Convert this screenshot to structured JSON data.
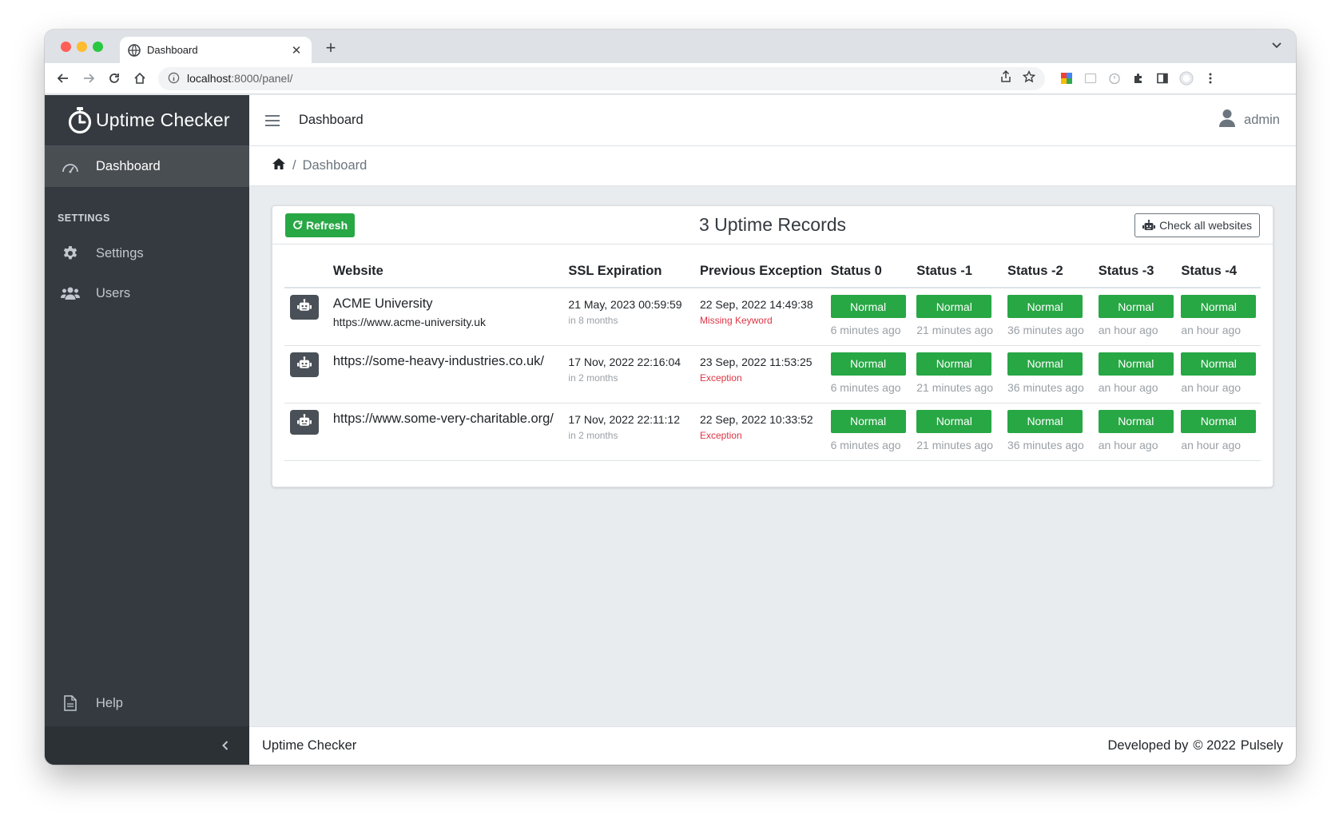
{
  "browser": {
    "tab_title": "Dashboard",
    "tab_close": "✕",
    "new_tab": "+",
    "url_host": "localhost",
    "url_path": ":8000/panel/"
  },
  "sidebar": {
    "brand": "Uptime Checker",
    "items": [
      {
        "label": "Dashboard",
        "icon": "tachometer-icon"
      },
      {
        "label": "Settings",
        "icon": "gear-icon"
      },
      {
        "label": "Users",
        "icon": "users-icon"
      }
    ],
    "section_header": "SETTINGS",
    "help_label": "Help",
    "collapse_glyph": "‹"
  },
  "topnav": {
    "title": "Dashboard",
    "user": "admin"
  },
  "breadcrumb": {
    "separator": "/",
    "current": "Dashboard"
  },
  "card": {
    "refresh_label": "Refresh",
    "title": "3 Uptime Records",
    "check_all_label": "Check all websites"
  },
  "table": {
    "headers": [
      "Website",
      "SSL Expiration",
      "Previous Exception",
      "Status 0",
      "Status -1",
      "Status -2",
      "Status -3",
      "Status -4"
    ],
    "rows": [
      {
        "name": "ACME University",
        "url": "https://www.acme-university.uk",
        "ssl_date": "21 May, 2023 00:59:59",
        "ssl_rel": "in 8 months",
        "exc_date": "22 Sep, 2022 14:49:38",
        "exc_type": "Missing Keyword",
        "statuses": [
          {
            "label": "Normal",
            "time": "6 minutes ago"
          },
          {
            "label": "Normal",
            "time": "21 minutes ago"
          },
          {
            "label": "Normal",
            "time": "36 minutes ago"
          },
          {
            "label": "Normal",
            "time": "an hour ago"
          },
          {
            "label": "Normal",
            "time": "an hour ago"
          }
        ]
      },
      {
        "name": "https://some-heavy-industries.co.uk/",
        "url": "",
        "ssl_date": "17 Nov, 2022 22:16:04",
        "ssl_rel": "in 2 months",
        "exc_date": "23 Sep, 2022 11:53:25",
        "exc_type": "Exception",
        "statuses": [
          {
            "label": "Normal",
            "time": "6 minutes ago"
          },
          {
            "label": "Normal",
            "time": "21 minutes ago"
          },
          {
            "label": "Normal",
            "time": "36 minutes ago"
          },
          {
            "label": "Normal",
            "time": "an hour ago"
          },
          {
            "label": "Normal",
            "time": "an hour ago"
          }
        ]
      },
      {
        "name": "https://www.some-very-charitable.org/",
        "url": "",
        "ssl_date": "17 Nov, 2022 22:11:12",
        "ssl_rel": "in 2 months",
        "exc_date": "22 Sep, 2022 10:33:52",
        "exc_type": "Exception",
        "statuses": [
          {
            "label": "Normal",
            "time": "6 minutes ago"
          },
          {
            "label": "Normal",
            "time": "21 minutes ago"
          },
          {
            "label": "Normal",
            "time": "36 minutes ago"
          },
          {
            "label": "Normal",
            "time": "an hour ago"
          },
          {
            "label": "Normal",
            "time": "an hour ago"
          }
        ]
      }
    ]
  },
  "footer": {
    "left": "Uptime Checker",
    "developed_by": "Developed by",
    "copyright": "© 2022",
    "company": "Pulsely"
  },
  "colors": {
    "sidebar_bg": "#343a40",
    "success": "#28a745",
    "danger": "#dc3545",
    "page_bg": "#e9ecef"
  }
}
